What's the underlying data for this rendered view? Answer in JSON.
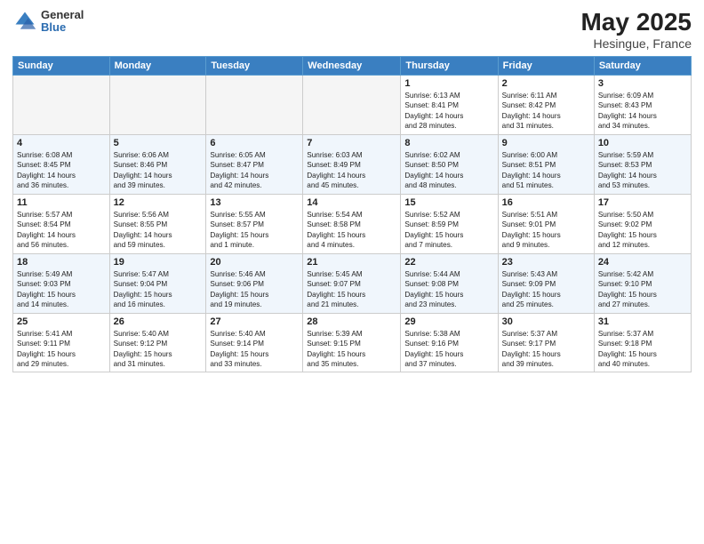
{
  "logo": {
    "general": "General",
    "blue": "Blue"
  },
  "header": {
    "title": "May 2025",
    "subtitle": "Hesingue, France"
  },
  "days": [
    "Sunday",
    "Monday",
    "Tuesday",
    "Wednesday",
    "Thursday",
    "Friday",
    "Saturday"
  ],
  "weeks": [
    [
      {
        "num": "",
        "content": ""
      },
      {
        "num": "",
        "content": ""
      },
      {
        "num": "",
        "content": ""
      },
      {
        "num": "",
        "content": ""
      },
      {
        "num": "1",
        "content": "Sunrise: 6:13 AM\nSunset: 8:41 PM\nDaylight: 14 hours\nand 28 minutes."
      },
      {
        "num": "2",
        "content": "Sunrise: 6:11 AM\nSunset: 8:42 PM\nDaylight: 14 hours\nand 31 minutes."
      },
      {
        "num": "3",
        "content": "Sunrise: 6:09 AM\nSunset: 8:43 PM\nDaylight: 14 hours\nand 34 minutes."
      }
    ],
    [
      {
        "num": "4",
        "content": "Sunrise: 6:08 AM\nSunset: 8:45 PM\nDaylight: 14 hours\nand 36 minutes."
      },
      {
        "num": "5",
        "content": "Sunrise: 6:06 AM\nSunset: 8:46 PM\nDaylight: 14 hours\nand 39 minutes."
      },
      {
        "num": "6",
        "content": "Sunrise: 6:05 AM\nSunset: 8:47 PM\nDaylight: 14 hours\nand 42 minutes."
      },
      {
        "num": "7",
        "content": "Sunrise: 6:03 AM\nSunset: 8:49 PM\nDaylight: 14 hours\nand 45 minutes."
      },
      {
        "num": "8",
        "content": "Sunrise: 6:02 AM\nSunset: 8:50 PM\nDaylight: 14 hours\nand 48 minutes."
      },
      {
        "num": "9",
        "content": "Sunrise: 6:00 AM\nSunset: 8:51 PM\nDaylight: 14 hours\nand 51 minutes."
      },
      {
        "num": "10",
        "content": "Sunrise: 5:59 AM\nSunset: 8:53 PM\nDaylight: 14 hours\nand 53 minutes."
      }
    ],
    [
      {
        "num": "11",
        "content": "Sunrise: 5:57 AM\nSunset: 8:54 PM\nDaylight: 14 hours\nand 56 minutes."
      },
      {
        "num": "12",
        "content": "Sunrise: 5:56 AM\nSunset: 8:55 PM\nDaylight: 14 hours\nand 59 minutes."
      },
      {
        "num": "13",
        "content": "Sunrise: 5:55 AM\nSunset: 8:57 PM\nDaylight: 15 hours\nand 1 minute."
      },
      {
        "num": "14",
        "content": "Sunrise: 5:54 AM\nSunset: 8:58 PM\nDaylight: 15 hours\nand 4 minutes."
      },
      {
        "num": "15",
        "content": "Sunrise: 5:52 AM\nSunset: 8:59 PM\nDaylight: 15 hours\nand 7 minutes."
      },
      {
        "num": "16",
        "content": "Sunrise: 5:51 AM\nSunset: 9:01 PM\nDaylight: 15 hours\nand 9 minutes."
      },
      {
        "num": "17",
        "content": "Sunrise: 5:50 AM\nSunset: 9:02 PM\nDaylight: 15 hours\nand 12 minutes."
      }
    ],
    [
      {
        "num": "18",
        "content": "Sunrise: 5:49 AM\nSunset: 9:03 PM\nDaylight: 15 hours\nand 14 minutes."
      },
      {
        "num": "19",
        "content": "Sunrise: 5:47 AM\nSunset: 9:04 PM\nDaylight: 15 hours\nand 16 minutes."
      },
      {
        "num": "20",
        "content": "Sunrise: 5:46 AM\nSunset: 9:06 PM\nDaylight: 15 hours\nand 19 minutes."
      },
      {
        "num": "21",
        "content": "Sunrise: 5:45 AM\nSunset: 9:07 PM\nDaylight: 15 hours\nand 21 minutes."
      },
      {
        "num": "22",
        "content": "Sunrise: 5:44 AM\nSunset: 9:08 PM\nDaylight: 15 hours\nand 23 minutes."
      },
      {
        "num": "23",
        "content": "Sunrise: 5:43 AM\nSunset: 9:09 PM\nDaylight: 15 hours\nand 25 minutes."
      },
      {
        "num": "24",
        "content": "Sunrise: 5:42 AM\nSunset: 9:10 PM\nDaylight: 15 hours\nand 27 minutes."
      }
    ],
    [
      {
        "num": "25",
        "content": "Sunrise: 5:41 AM\nSunset: 9:11 PM\nDaylight: 15 hours\nand 29 minutes."
      },
      {
        "num": "26",
        "content": "Sunrise: 5:40 AM\nSunset: 9:12 PM\nDaylight: 15 hours\nand 31 minutes."
      },
      {
        "num": "27",
        "content": "Sunrise: 5:40 AM\nSunset: 9:14 PM\nDaylight: 15 hours\nand 33 minutes."
      },
      {
        "num": "28",
        "content": "Sunrise: 5:39 AM\nSunset: 9:15 PM\nDaylight: 15 hours\nand 35 minutes."
      },
      {
        "num": "29",
        "content": "Sunrise: 5:38 AM\nSunset: 9:16 PM\nDaylight: 15 hours\nand 37 minutes."
      },
      {
        "num": "30",
        "content": "Sunrise: 5:37 AM\nSunset: 9:17 PM\nDaylight: 15 hours\nand 39 minutes."
      },
      {
        "num": "31",
        "content": "Sunrise: 5:37 AM\nSunset: 9:18 PM\nDaylight: 15 hours\nand 40 minutes."
      }
    ]
  ]
}
